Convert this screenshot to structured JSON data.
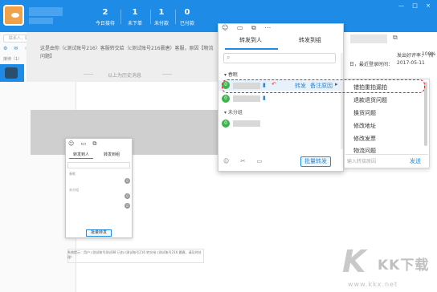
{
  "window": {
    "controls": "— □ ×"
  },
  "profile": {
    "name": "",
    "status": ""
  },
  "stats": [
    {
      "num": "2",
      "label": "今日接待"
    },
    {
      "num": "1",
      "label": "未下单"
    },
    {
      "num": "1",
      "label": "未付款"
    },
    {
      "num": "0",
      "label": "已付款"
    }
  ],
  "left": {
    "search_placeholder": "联系人，聊天记录",
    "tabs": "⚙ ✉ ☆",
    "label": "接待（1）"
  },
  "history": {
    "text": "这是由你（c测试账号216）客服转交给（c测试账号216晨唐）客服，原因【物流问题】",
    "footer": "以上为历史消息"
  },
  "mini": {
    "icons": "☺ ▭ ⧉",
    "tab_forward_person": "转发到人",
    "tab_forward_group": "转发到组",
    "group_store": "春眠",
    "group_ungrouped": "未分组",
    "badge_zero": "0",
    "batch_button": "批量转发",
    "footer": "系统提示：用户 c测试账号测试88 已由 c测试账号216 转交给 c测试账号216 晨唐，请及时处理！"
  },
  "forward": {
    "icons": "☺ ▭ ⧉ ⋯",
    "tab_person": "转发到人",
    "tab_group": "转发到组",
    "search_placeholder": "",
    "group_store": "春眠",
    "group_ungrouped": "未分组",
    "badge": "0",
    "forward_link": "转发",
    "note_link": "备注原因",
    "arrow": "▸",
    "batch_button": "批量转发"
  },
  "reasons": {
    "items": [
      "错拍重拍漏拍",
      "退款退货问题",
      "换货问题",
      "修改地址",
      "修改发票",
      "物流问题"
    ],
    "input_placeholder": "输入转接原因",
    "send": "发送"
  },
  "info": {
    "good_rate_label": "发出好评率：",
    "good_rate_value": "100%",
    "last_login_label": "日，最近登录时间：",
    "last_login_value": "2017-05-11",
    "extra": "所"
  },
  "ghost": {
    "value": "214"
  },
  "watermark": {
    "logo": "K",
    "text": "KK下载",
    "url": "www.kkx.net"
  }
}
